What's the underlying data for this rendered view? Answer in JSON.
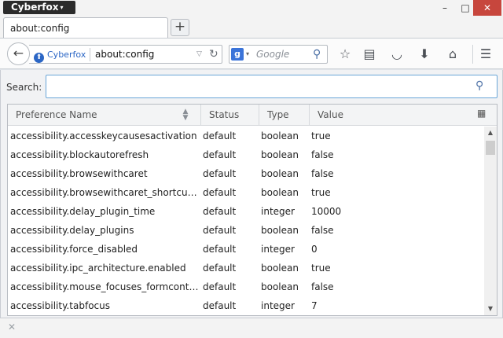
{
  "titlebar": {
    "app_menu": "Cyberfox",
    "app_menu_caret": "▾",
    "min_glyph": "–",
    "max_glyph": "□",
    "close_glyph": "✕"
  },
  "tabs": [
    {
      "label": "about:config"
    }
  ],
  "newtab_glyph": "+",
  "navbar": {
    "back_glyph": "←",
    "identity_label": "Cyberfox",
    "url": "about:config",
    "search_engine_letter": "g",
    "search_placeholder": "Google",
    "icons": [
      "bookmark-star-icon",
      "reading-list-icon",
      "pocket-icon",
      "download-icon",
      "home-icon",
      "menu-icon"
    ]
  },
  "config": {
    "search_label": "Search:",
    "search_value": "",
    "columns": [
      "Preference Name",
      "Status",
      "Type",
      "Value"
    ],
    "rows": [
      {
        "name": "accessibility.accesskeycausesactivation",
        "status": "default",
        "type": "boolean",
        "value": "true"
      },
      {
        "name": "accessibility.blockautorefresh",
        "status": "default",
        "type": "boolean",
        "value": "false"
      },
      {
        "name": "accessibility.browsewithcaret",
        "status": "default",
        "type": "boolean",
        "value": "false"
      },
      {
        "name": "accessibility.browsewithcaret_shortcut.enabled",
        "status": "default",
        "type": "boolean",
        "value": "true"
      },
      {
        "name": "accessibility.delay_plugin_time",
        "status": "default",
        "type": "integer",
        "value": "10000"
      },
      {
        "name": "accessibility.delay_plugins",
        "status": "default",
        "type": "boolean",
        "value": "false"
      },
      {
        "name": "accessibility.force_disabled",
        "status": "default",
        "type": "integer",
        "value": "0"
      },
      {
        "name": "accessibility.ipc_architecture.enabled",
        "status": "default",
        "type": "boolean",
        "value": "true"
      },
      {
        "name": "accessibility.mouse_focuses_formcontrol",
        "status": "default",
        "type": "boolean",
        "value": "false"
      },
      {
        "name": "accessibility.tabfocus",
        "status": "default",
        "type": "integer",
        "value": "7"
      }
    ]
  },
  "bottombar": {
    "close_glyph": "✕"
  }
}
